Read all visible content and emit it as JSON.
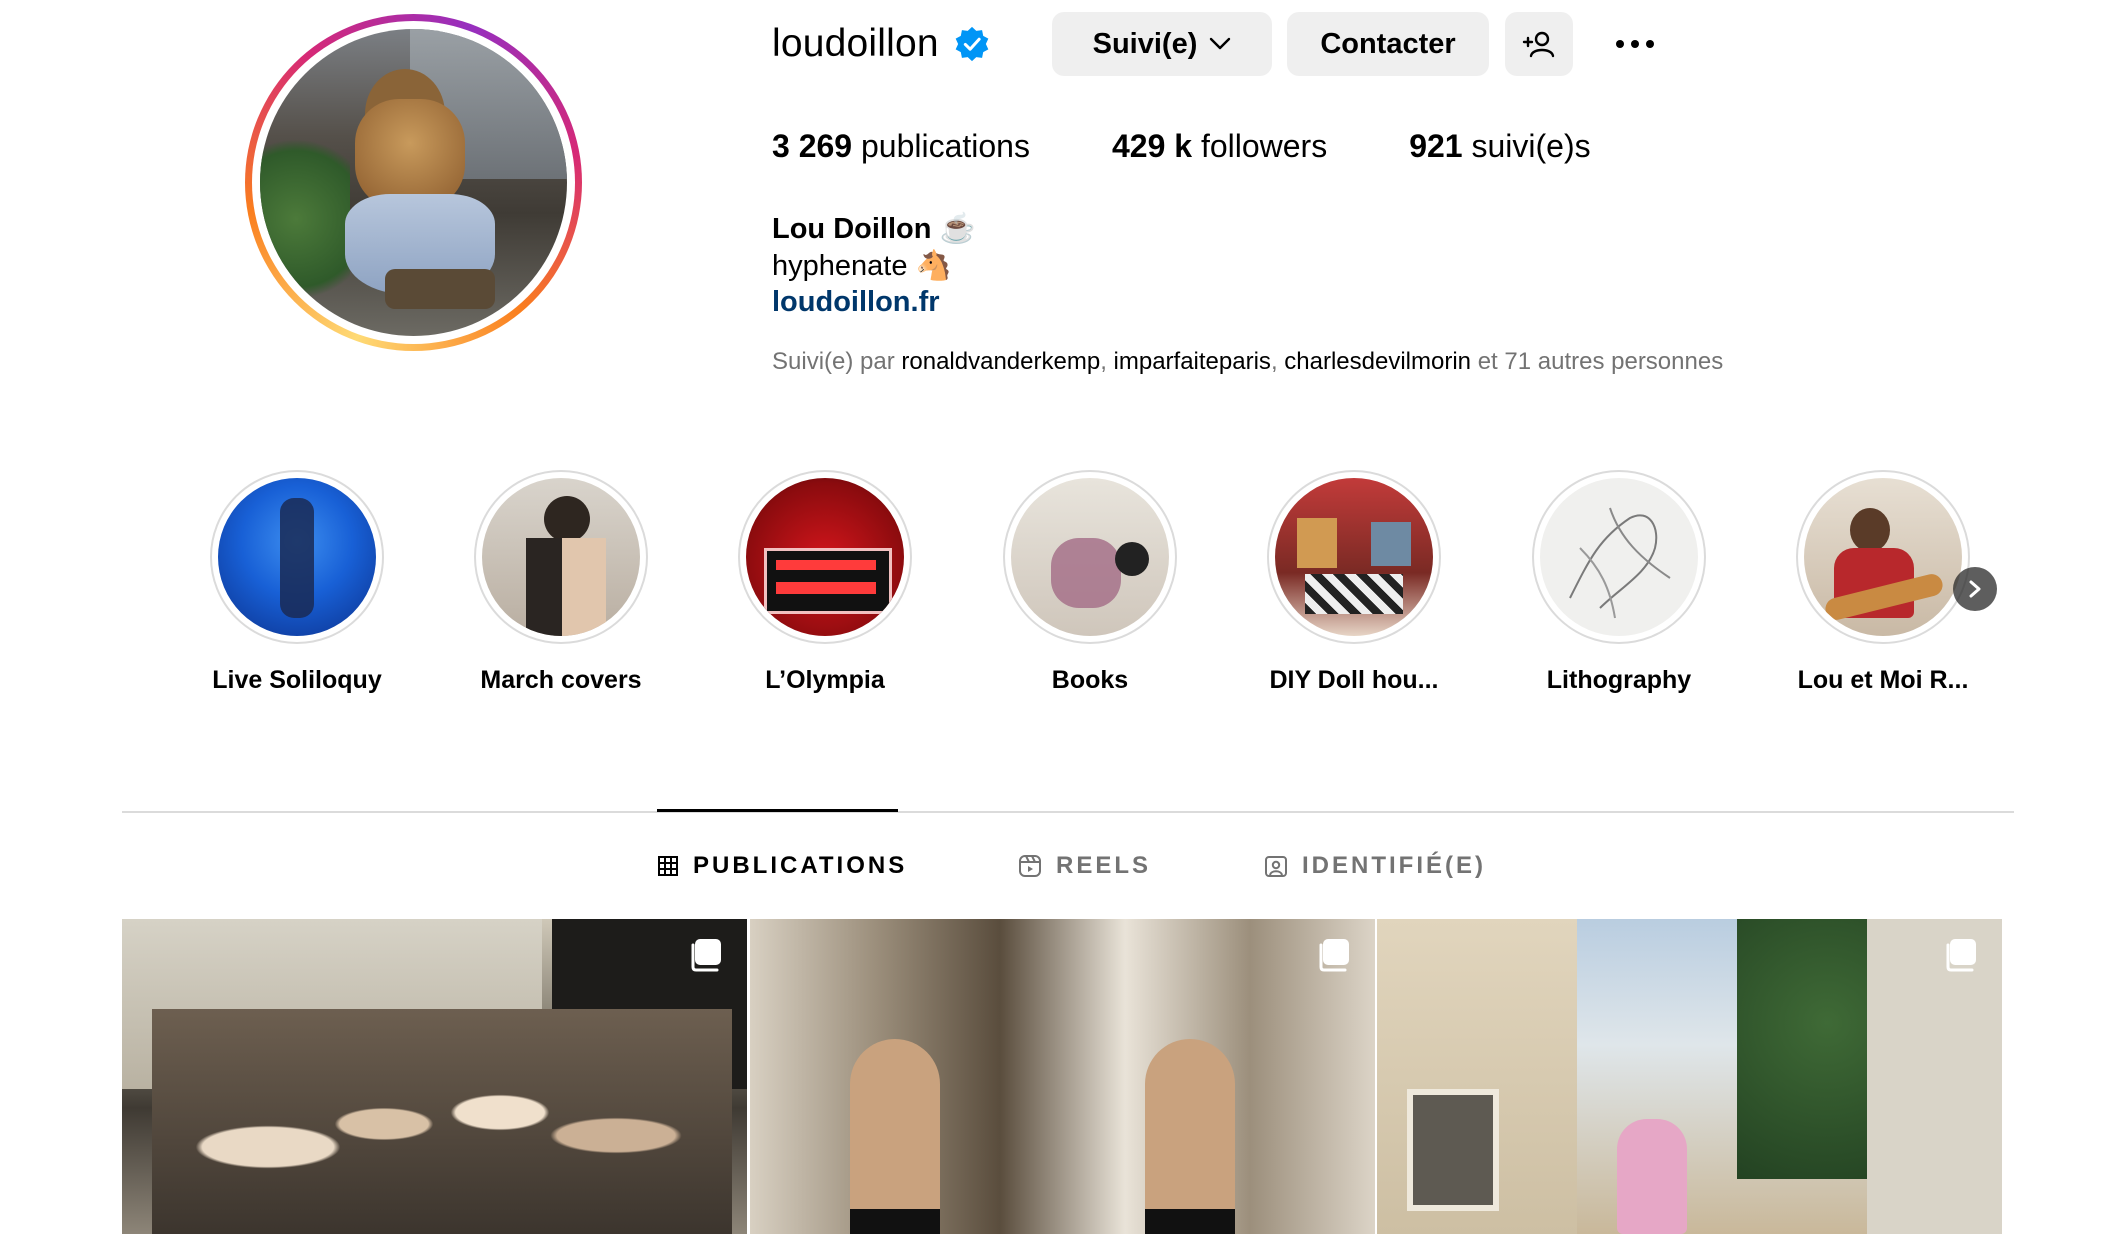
{
  "profile": {
    "username": "loudoillon",
    "verified": true,
    "follow_button": "Suivi(e)",
    "contact_button": "Contacter",
    "stats": [
      {
        "value": "3 269",
        "label": "publications"
      },
      {
        "value": "429 k",
        "label": "followers"
      },
      {
        "value": "921",
        "label": "suivi(e)s"
      }
    ],
    "full_name": "Lou Doillon ☕",
    "bio": "hyphenate 🐴",
    "website": "loudoillon.fr",
    "followed_by": {
      "prefix": "Suivi(e) par",
      "accounts": [
        "ronaldvanderkemp",
        "imparfaiteparis",
        "charlesdevilmorin"
      ],
      "sep": ",",
      "suffix": "et 71 autres personnes"
    }
  },
  "highlights": [
    {
      "label": "Live Soliloquy",
      "icon": "highlight-cover"
    },
    {
      "label": "March covers",
      "icon": "highlight-cover"
    },
    {
      "label": "L’Olympia",
      "icon": "highlight-cover"
    },
    {
      "label": "Books",
      "icon": "highlight-cover"
    },
    {
      "label": "DIY Doll hou...",
      "icon": "highlight-cover"
    },
    {
      "label": "Lithography",
      "icon": "highlight-cover"
    },
    {
      "label": "Lou et Moi R...",
      "icon": "highlight-cover"
    }
  ],
  "tabs": [
    {
      "label": "PUBLICATIONS",
      "icon": "grid-icon",
      "active": true
    },
    {
      "label": "REELS",
      "icon": "reels-icon",
      "active": false
    },
    {
      "label": "IDENTIFIÉ(E)",
      "icon": "tagged-icon",
      "active": false
    }
  ],
  "colors": {
    "verified": "#0095f6",
    "link": "#00376b",
    "button_bg": "#efefef",
    "muted_text": "#737373",
    "divider": "#dbdbdb"
  }
}
